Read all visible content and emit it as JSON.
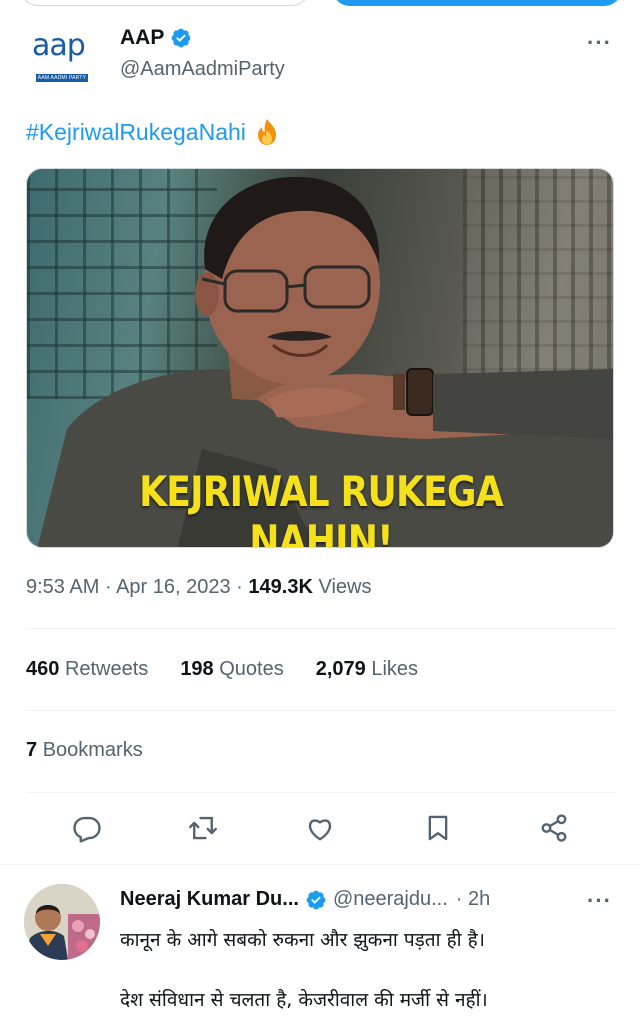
{
  "tweet": {
    "display_name": "AAP",
    "handle": "@AamAadmiParty",
    "logo_text": "aap",
    "logo_band_text": "AAM AADMI PARTY",
    "more_icon": "···",
    "hashtag": "#KejriwalRukegaNahi",
    "media_caption": "KEJRIWAL RUKEGA NAHIN!",
    "time": "9:53 AM",
    "date": "Apr 16, 2023",
    "views_count": "149.3K",
    "views_label": "Views",
    "retweets_count": "460",
    "retweets_label": "Retweets",
    "quotes_count": "198",
    "quotes_label": "Quotes",
    "likes_count": "2,079",
    "likes_label": "Likes",
    "bookmarks_count": "7",
    "bookmarks_label": "Bookmarks",
    "dot": "·"
  },
  "reply": {
    "display_name": "Neeraj Kumar Du...",
    "handle": "@neerajdu...",
    "time": "· 2h",
    "more_icon": "···",
    "line1": "कानून के आगे सबको रुकना और झुकना पड़ता ही है।",
    "line2": "देश संविधान से चलता है, केजरीवाल की मर्जी से नहीं।"
  },
  "colors": {
    "accent": "#1d9bf0",
    "secondary_text": "#536471",
    "caption_yellow": "#f5e11a",
    "logo_blue": "#1a5ca8"
  },
  "icons": [
    "verified-badge-icon",
    "fire-emoji-icon",
    "reply-icon",
    "retweet-icon",
    "like-icon",
    "bookmark-icon",
    "share-icon"
  ]
}
